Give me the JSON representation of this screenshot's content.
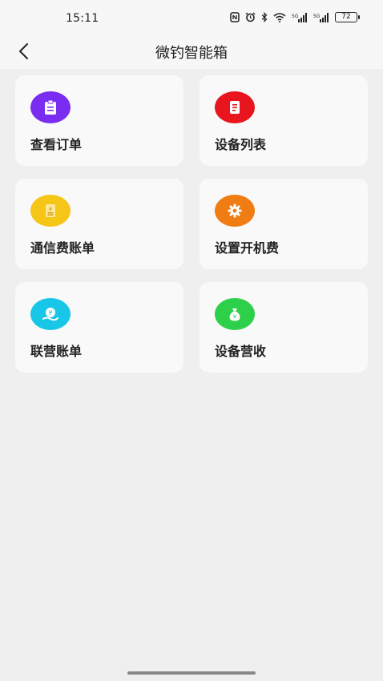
{
  "status_bar": {
    "time": "15:11",
    "battery": "72",
    "icons": [
      "nfc-icon",
      "alarm-icon",
      "bluetooth-icon",
      "wifi-icon",
      "signal-icon",
      "signal-icon",
      "battery-icon"
    ]
  },
  "header": {
    "title": "微钓智能箱",
    "back_icon": "chevron-left-icon"
  },
  "menu": [
    {
      "label": "查看订单",
      "icon": "clipboard-icon",
      "color": "#7a2cf0"
    },
    {
      "label": "设备列表",
      "icon": "document-list-icon",
      "color": "#e8141e"
    },
    {
      "label": "通信费账单",
      "icon": "bill-icon",
      "color": "#f5c518"
    },
    {
      "label": "设置开机费",
      "icon": "gear-icon",
      "color": "#f07d14"
    },
    {
      "label": "联营账单",
      "icon": "yuan-hand-icon",
      "color": "#18c6e8"
    },
    {
      "label": "设备营收",
      "icon": "money-bag-icon",
      "color": "#2ed04a"
    }
  ]
}
